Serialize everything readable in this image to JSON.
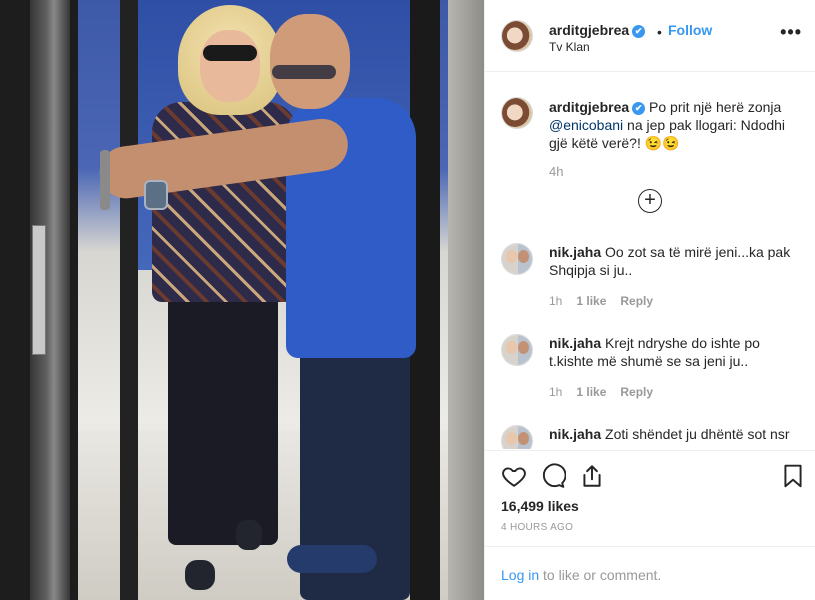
{
  "post": {
    "username": "arditgjebrea",
    "verified_mark": "✔",
    "separator": "•",
    "follow_label": "Follow",
    "location": "Tv Klan",
    "more_label": "•••"
  },
  "caption": {
    "username": "arditgjebrea",
    "verified_mark": "✔",
    "text_before": " Po prit një herë zonja ",
    "mention": "@enicobani",
    "text_after": " na jep pak llogari: Ndodhi gjë këtë verë?! 😉😉",
    "time": "4h",
    "load_more_symbol": "+"
  },
  "comments": [
    {
      "username": "nik.jaha",
      "text": " Oo zot sa të mirë jeni...ka pak Shqipja si ju..",
      "time": "1h",
      "likes": "1 like",
      "reply": "Reply"
    },
    {
      "username": "nik.jaha",
      "text": " Krejt ndryshe do ishte po t.kishte më shumë se sa jeni ju..",
      "time": "1h",
      "likes": "1 like",
      "reply": "Reply"
    },
    {
      "username": "nik.jaha",
      "text": " Zoti shëndet ju dhëntë sot nsr",
      "time": "",
      "likes": "",
      "reply": ""
    }
  ],
  "actions": {
    "like_icon": "heart-icon",
    "comment_icon": "comment-icon",
    "share_icon": "share-icon",
    "save_icon": "bookmark-icon",
    "likes_count": "16,499 likes",
    "time_ago": "4 HOURS AGO"
  },
  "login": {
    "link": "Log in",
    "rest": " to like or comment."
  },
  "colors": {
    "accent": "#3897f0",
    "text": "#262626",
    "muted": "#999999",
    "border": "#efefef",
    "mention": "#003569"
  }
}
